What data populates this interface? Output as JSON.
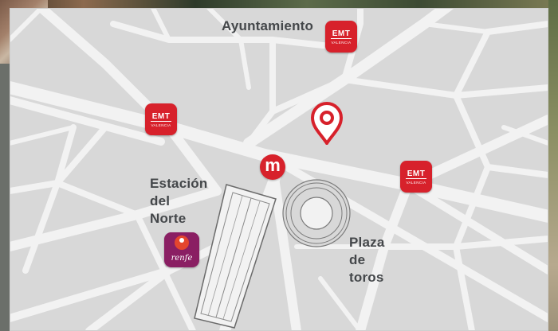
{
  "map": {
    "labels": {
      "ayuntamiento": "Ayuntamiento",
      "estacion_l1": "Estación",
      "estacion_l2": "del",
      "estacion_l3": "Norte",
      "plaza_l1": "Plaza",
      "plaza_l2": "de",
      "plaza_l3": "toros"
    },
    "markers": {
      "emt_text": "EMT",
      "emt_subtext": "VALENCIA",
      "metro_text": "m",
      "renfe_text": "renfe"
    },
    "colors": {
      "map_bg": "#d8d8d8",
      "road": "#f2f2f2",
      "brand_red": "#d7212b",
      "renfe_purple": "#8a1f63",
      "label_text": "#44474a"
    },
    "icons": {
      "location_pin": "location-pin-icon",
      "emt": "emt-bus-icon",
      "metro": "metro-icon",
      "renfe": "renfe-train-icon"
    }
  }
}
